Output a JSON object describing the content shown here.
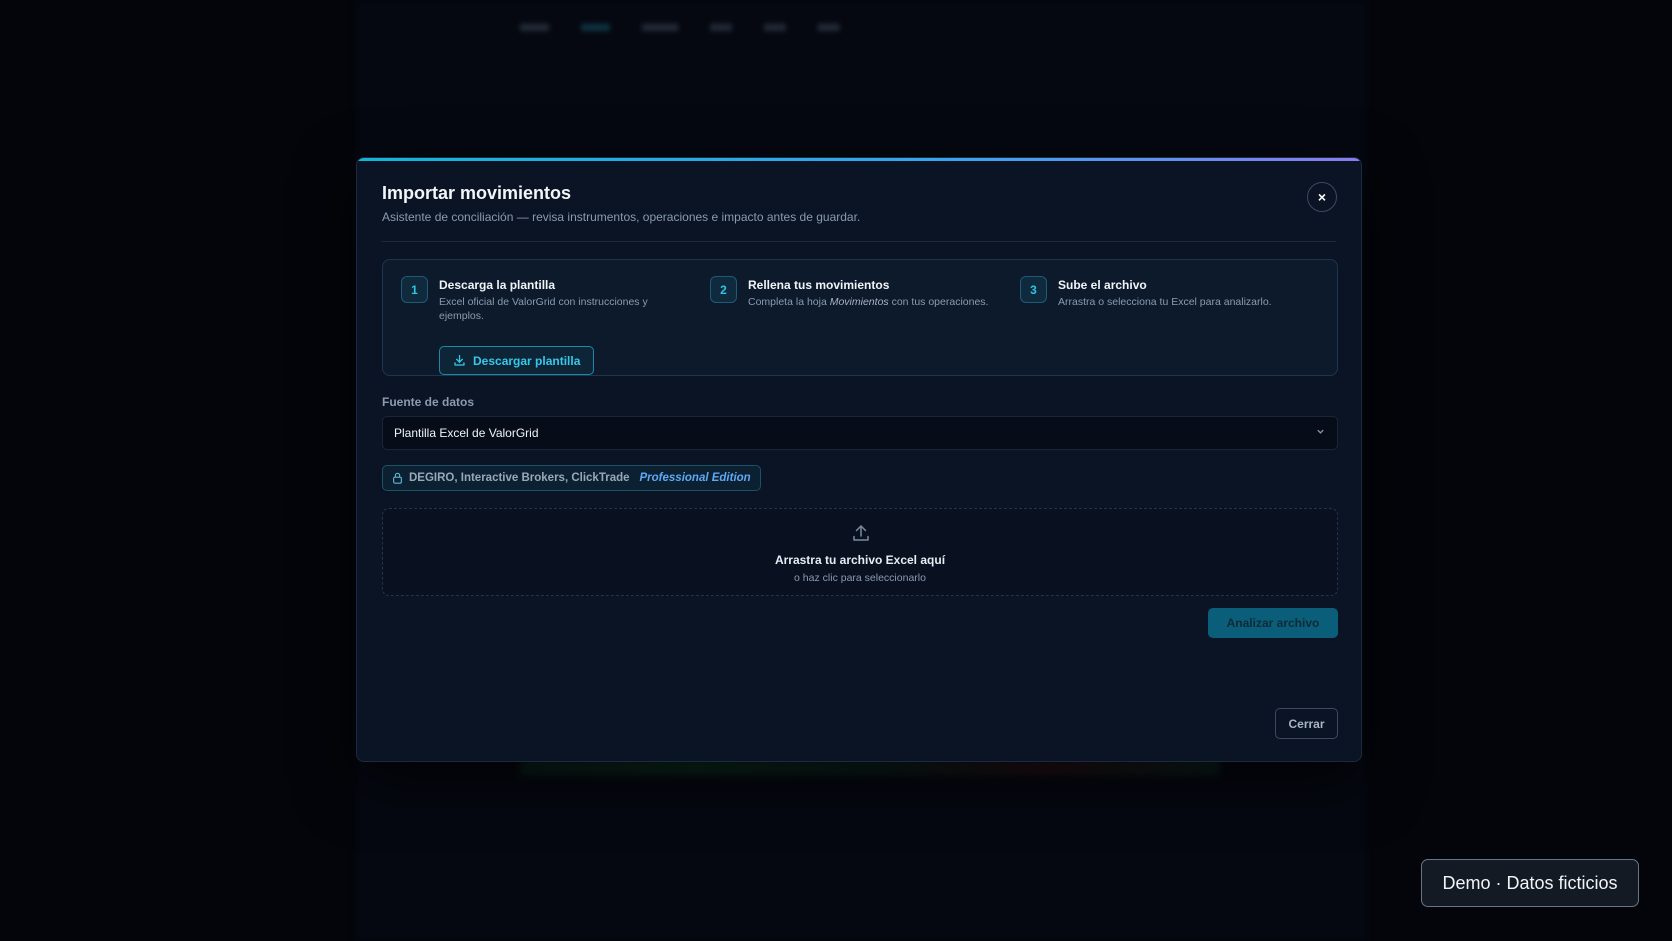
{
  "modal": {
    "title": "Importar movimientos",
    "subtitle": "Asistente de conciliación — revisa instrumentos, operaciones e impacto antes de guardar.",
    "close_glyph": "×",
    "steps": [
      {
        "number": "1",
        "title": "Descarga la plantilla",
        "desc_line1": "Excel oficial de ValorGrid con instrucciones y",
        "desc_line2": "ejemplos.",
        "button_label": "Descargar plantilla"
      },
      {
        "number": "2",
        "title": "Rellena tus movimientos",
        "desc_pre": "Completa la hoja ",
        "desc_em": "Movimientos",
        "desc_post": " con tus operaciones."
      },
      {
        "number": "3",
        "title": "Sube el archivo",
        "desc": "Arrastra o selecciona tu Excel para analizarlo."
      }
    ],
    "source": {
      "label": "Fuente de datos",
      "selected": "Plantilla Excel de ValorGrid"
    },
    "pro_badge": {
      "brokers": "DEGIRO, Interactive Brokers, ClickTrade",
      "edition": "Professional Edition"
    },
    "dropzone": {
      "title": "Arrastra tu archivo Excel aquí",
      "subtitle": "o haz clic para seleccionarlo"
    },
    "analyze_label": "Analizar archivo",
    "close_label": "Cerrar"
  },
  "demo_badge": "Demo · Datos ficticios",
  "colors": {
    "accent": "#2ec4e6",
    "modal_bg": "#0b1424",
    "edition": "#5ea8f5"
  }
}
